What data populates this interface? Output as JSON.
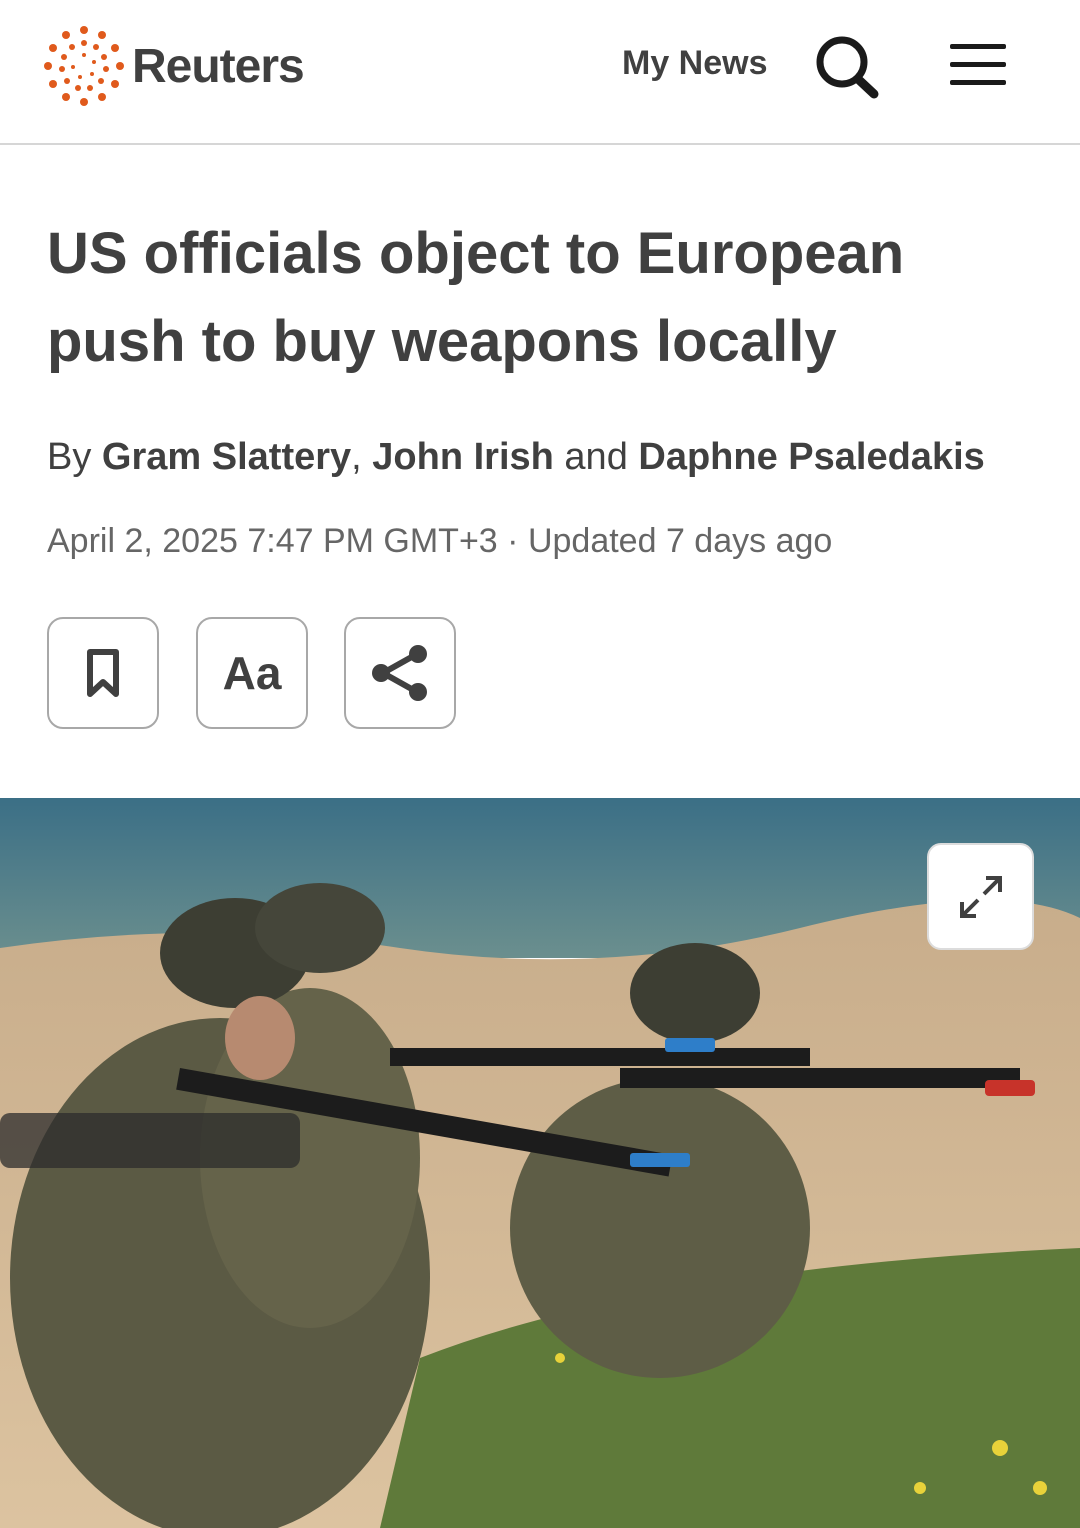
{
  "header": {
    "brand": "Reuters",
    "my_news": "My News"
  },
  "article": {
    "headline": "US officials object to European push to buy weapons locally",
    "byline": {
      "prefix": "By",
      "author1": "Gram Slattery",
      "sep1": ",",
      "author2": "John Irish",
      "conj": "and",
      "author3": "Daphne Psaledakis"
    },
    "date": "April 2, 2025 7:47 PM GMT+3",
    "separator": "·",
    "updated": "Updated 7 days ago"
  },
  "actions": {
    "font_size_label": "Aa"
  },
  "icons": {
    "logo": "reuters-dots-logo",
    "search": "search-icon",
    "menu": "hamburger-menu-icon",
    "bookmark": "bookmark-icon",
    "share": "share-icon",
    "expand": "expand-icon"
  },
  "colors": {
    "brand_orange": "#e05a1c",
    "text": "#404040",
    "muted": "#666666"
  }
}
